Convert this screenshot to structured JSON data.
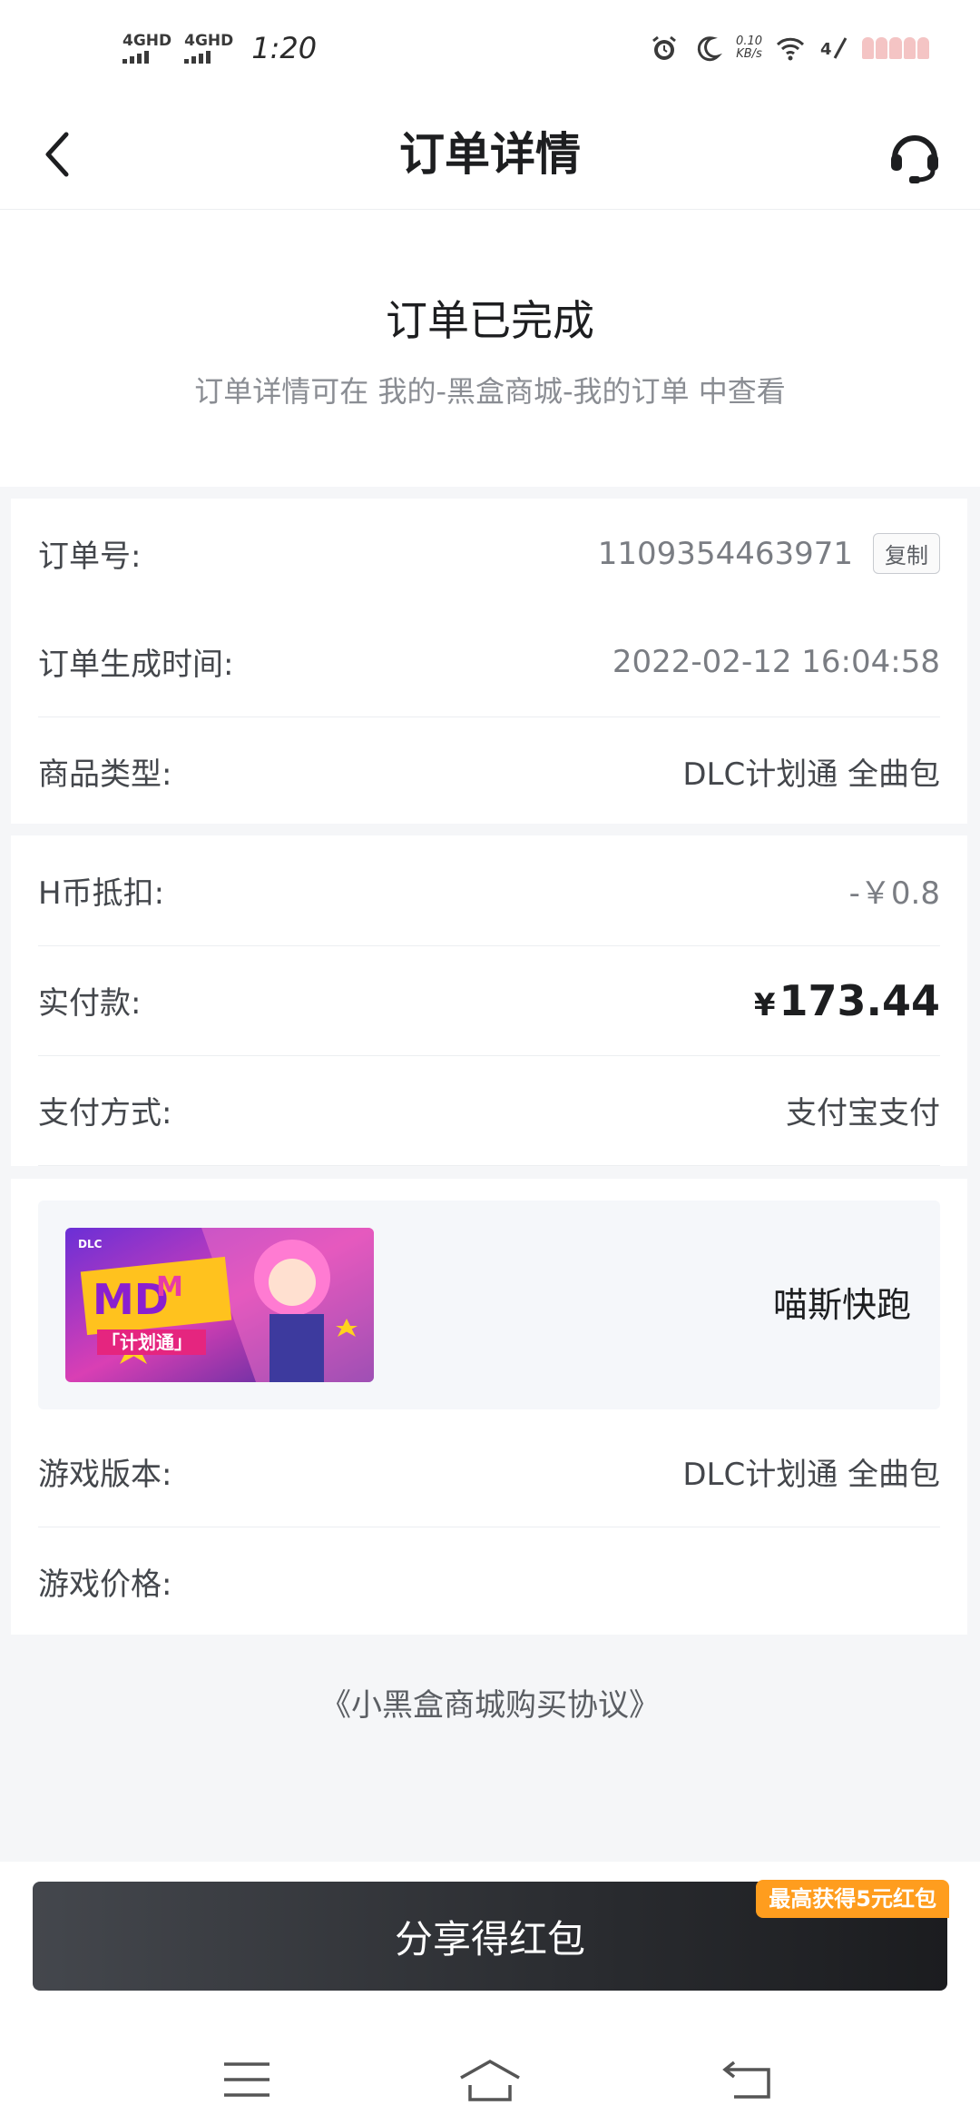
{
  "status_bar": {
    "signal_1": "4GHD",
    "signal_2": "4GHD",
    "time": "1:20",
    "net_speed_value": "0.10",
    "net_speed_unit": "KB/s",
    "icons": [
      "alarm-icon",
      "moon-icon",
      "wifi-icon",
      "signal-icon",
      "battery-icon"
    ]
  },
  "header": {
    "title": "订单详情",
    "back_icon": "chevron-left-icon",
    "service_icon": "headset-icon"
  },
  "order_status": {
    "title": "订单已完成",
    "subtitle": "订单详情可在 我的-黑盒商城-我的订单 中查看"
  },
  "order_info": {
    "order_no_label": "订单号:",
    "order_no_value": "1109354463971",
    "copy_label": "复制",
    "created_label": "订单生成时间:",
    "created_value": "2022-02-12 16:04:58",
    "type_label": "商品类型:",
    "type_value": "DLC计划通 全曲包"
  },
  "payment": {
    "coin_label": "H币抵扣:",
    "coin_value": "-￥0.8",
    "paid_label": "实付款:",
    "paid_currency": "¥",
    "paid_amount": "173.44",
    "method_label": "支付方式:",
    "method_value": "支付宝支付"
  },
  "product": {
    "image_name": "game-cover-image",
    "image_text_badge": "DLC",
    "image_text_banner": "「计划通」",
    "name": "喵斯快跑",
    "version_label": "游戏版本:",
    "version_value": "DLC计划通 全曲包",
    "price_label": "游戏价格:",
    "price_value": ""
  },
  "agreement": "《小黑盒商城购买协议》",
  "share": {
    "button_label": "分享得红包",
    "badge": "最高获得5元红包"
  },
  "navbar": {
    "icons": [
      "menu-icon",
      "home-icon",
      "back-nav-icon"
    ]
  },
  "colors": {
    "accent_orange": "#ff9d1e",
    "button_dark": "#2a2c30",
    "page_bg": "#f5f6f8"
  }
}
